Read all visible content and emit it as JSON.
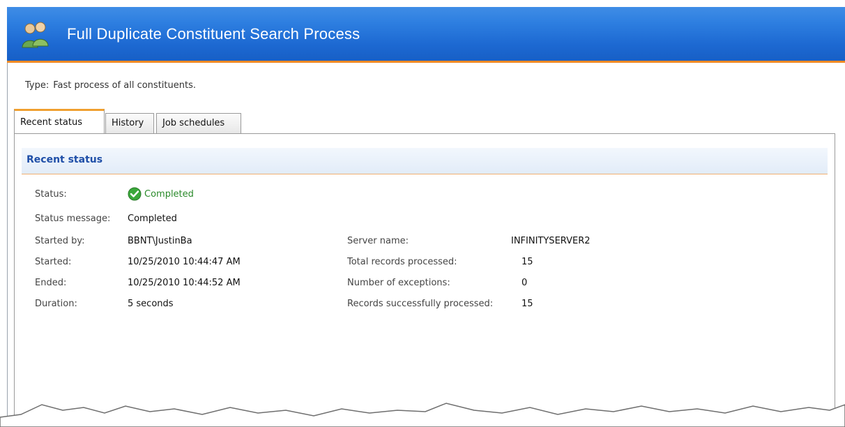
{
  "window": {
    "title": "Full Duplicate Constituent Search Process",
    "title_icon": "constituents-icon"
  },
  "type_line": {
    "label": "Type:",
    "value": "Fast process of all constituents."
  },
  "tabs": [
    {
      "label": "Recent status",
      "active": true
    },
    {
      "label": "History",
      "active": false
    },
    {
      "label": "Job schedules",
      "active": false
    }
  ],
  "section": {
    "title": "Recent status"
  },
  "status": {
    "status_label": "Status:",
    "status_value": "Completed",
    "status_icon": "completed-check-icon",
    "message_label": "Status message:",
    "message_value": "Completed",
    "started_by_label": "Started by:",
    "started_by_value": "BBNT\\JustinBa",
    "started_label": "Started:",
    "started_value": "10/25/2010 10:44:47 AM",
    "ended_label": "Ended:",
    "ended_value": "10/25/2010 10:44:52 AM",
    "duration_label": "Duration:",
    "duration_value": "5 seconds",
    "server_label": "Server name:",
    "server_value": "INFINITYSERVER2",
    "total_label": "Total records processed:",
    "total_value": "15",
    "exceptions_label": "Number of exceptions:",
    "exceptions_value": "0",
    "success_label": "Records successfully processed:",
    "success_value": "15"
  },
  "colors": {
    "header_blue": "#1d69d2",
    "header_accent_orange": "#f08a24",
    "section_title_blue": "#1f4fa8",
    "status_green": "#2a8a2a"
  }
}
